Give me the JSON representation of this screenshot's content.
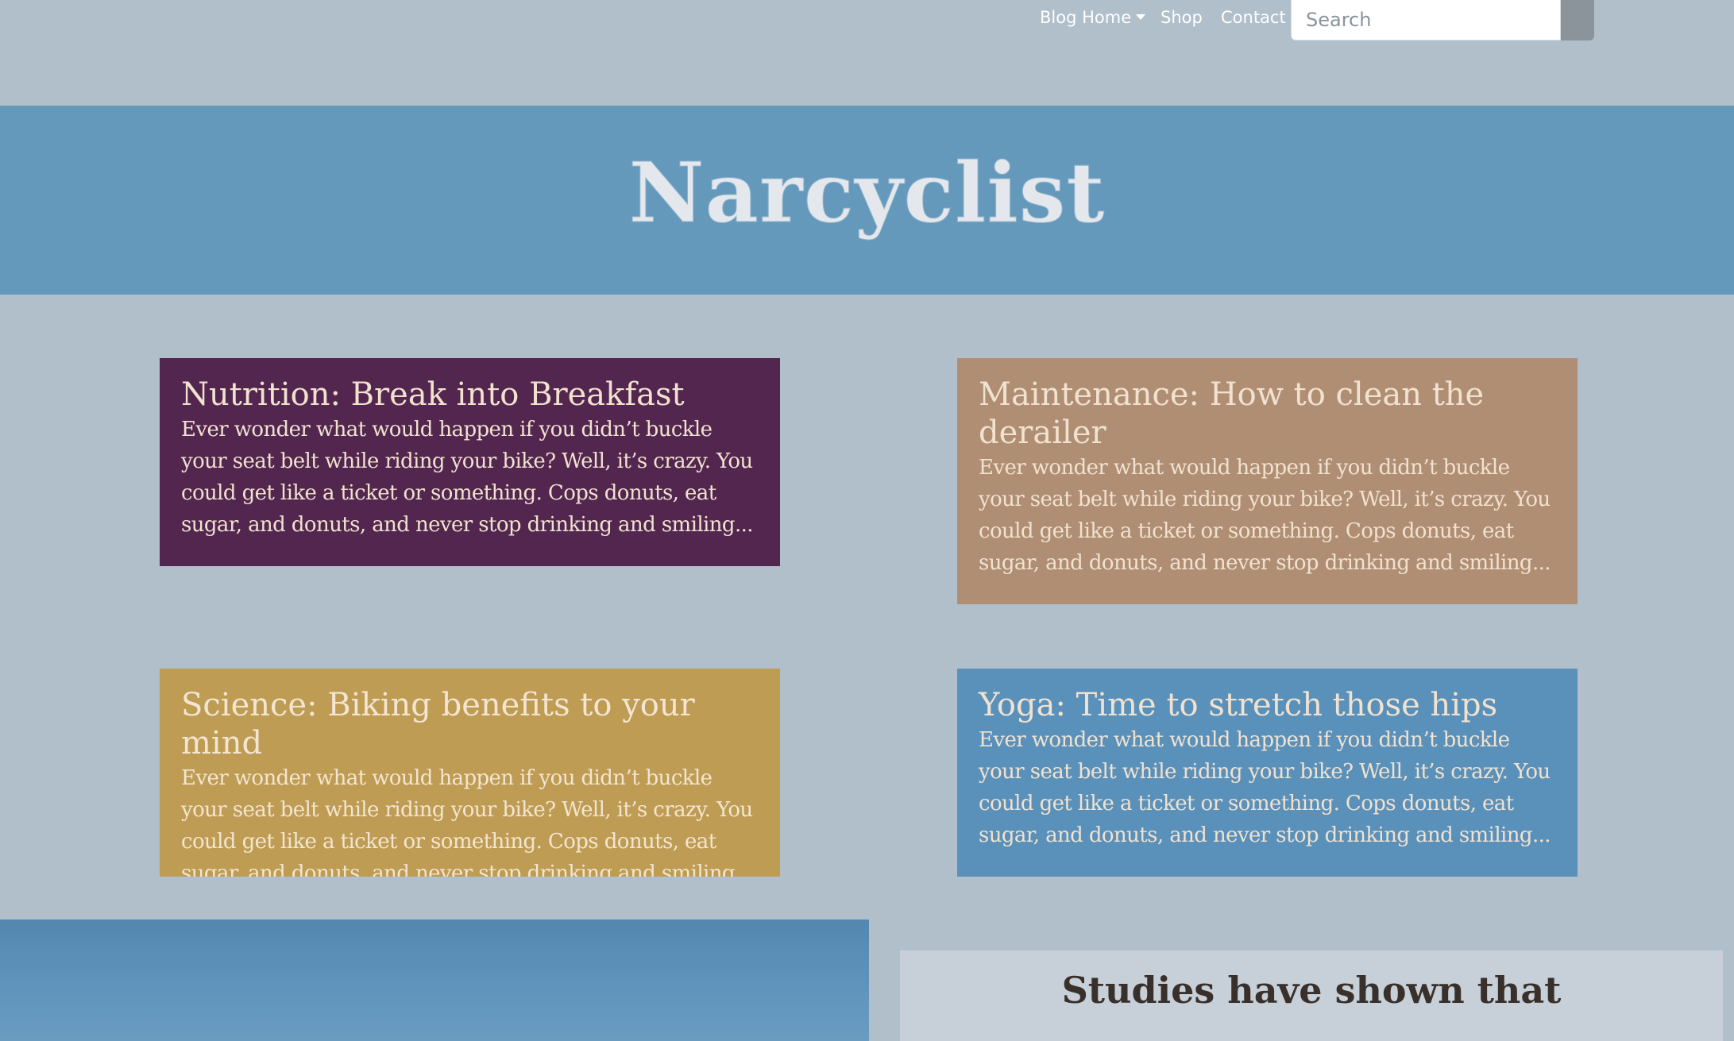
{
  "nav": {
    "links": [
      {
        "label": "Blog Home"
      },
      {
        "label": "Shop"
      },
      {
        "label": "Contact"
      }
    ],
    "search": {
      "placeholder": "Search",
      "value": ""
    }
  },
  "hero": {
    "title": "Narcyclist"
  },
  "cards": [
    {
      "title": "Nutrition: Break into Breakfast",
      "excerpt": "Ever wonder what would happen if you didn’t buckle your seat belt while riding your bike? Well, it’s crazy. You could get like a ticket or something. Cops donuts, eat sugar, and donuts, and never stop drinking and smiling...",
      "color": "#53264f"
    },
    {
      "title": "Maintenance: How to clean the derailer",
      "excerpt": "Ever wonder what would happen if you didn’t buckle your seat belt while riding your bike? Well, it’s crazy. You could get like a ticket or something. Cops donuts, eat sugar, and donuts, and never stop drinking and smiling...",
      "color": "#b08e74"
    },
    {
      "title": "Science: Biking benefits to your mind",
      "excerpt": "Ever wonder what would happen if you didn’t buckle your seat belt while riding your bike? Well, it’s crazy. You could get like a ticket or something. Cops donuts, eat sugar, and donuts, and never stop drinking and smiling...",
      "color": "#be9c53"
    },
    {
      "title": "Yoga: Time to stretch those hips",
      "excerpt": "Ever wonder what would happen if you didn’t buckle your seat belt while riding your bike? Well, it’s crazy. You could get like a ticket or something. Cops donuts, eat sugar, and donuts, and never stop drinking and smiling...",
      "color": "#5a91bb"
    }
  ],
  "studies": {
    "heading": "Studies have shown that"
  },
  "colors": {
    "page_background": "#b1bfcb",
    "hero_background": "#6499bc",
    "search_button": "#8b939b"
  }
}
